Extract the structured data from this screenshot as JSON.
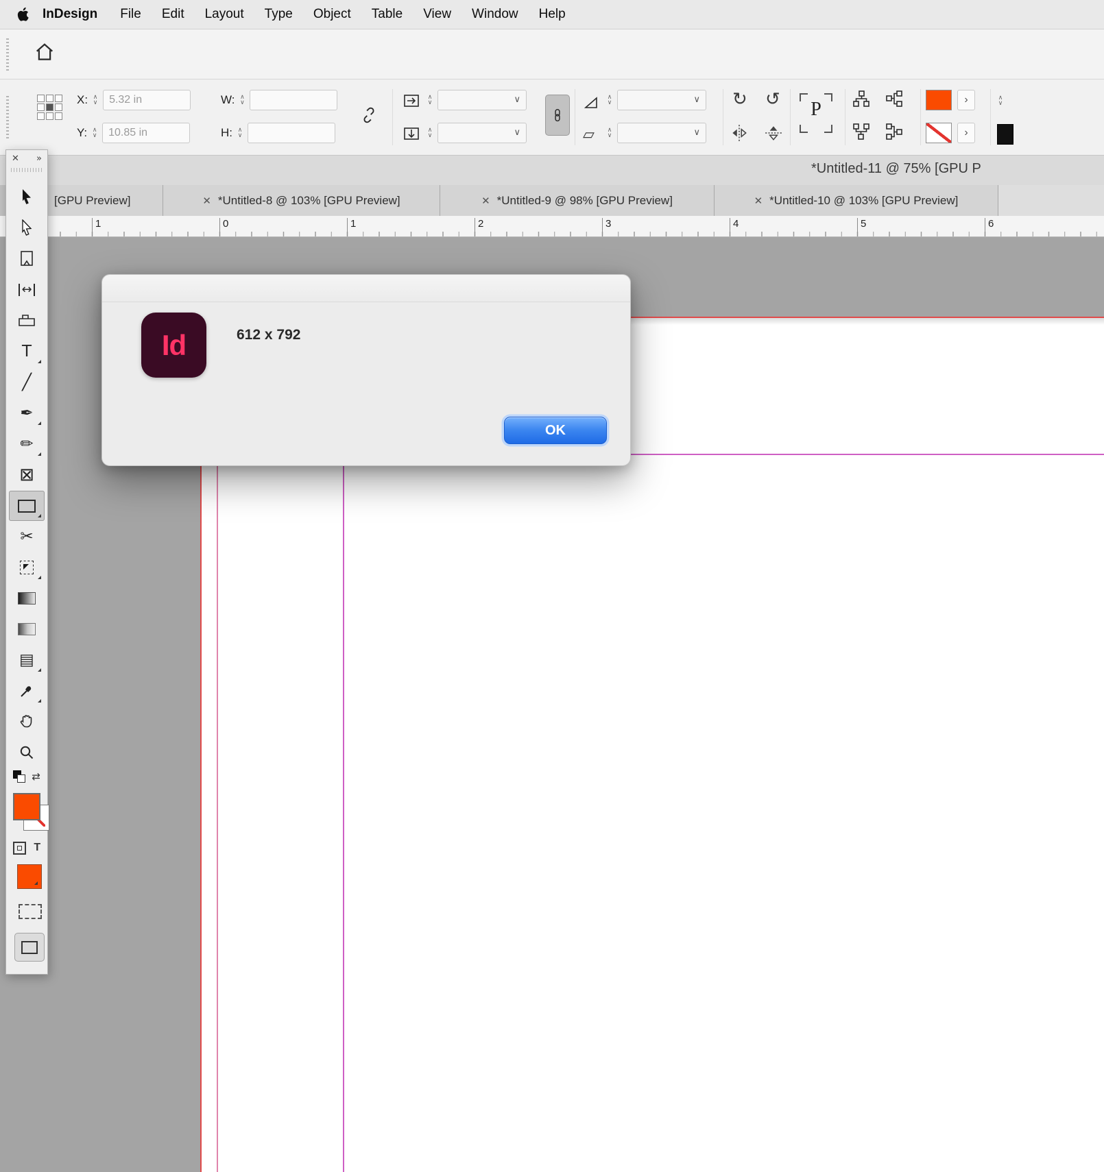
{
  "menu_bar": {
    "app_name": "InDesign",
    "items": [
      "File",
      "Edit",
      "Layout",
      "Type",
      "Object",
      "Table",
      "View",
      "Window",
      "Help"
    ]
  },
  "control_panel": {
    "x_label": "X:",
    "x_value": "5.32 in",
    "y_label": "Y:",
    "y_value": "10.85 in",
    "w_label": "W:",
    "w_value": "",
    "h_label": "H:",
    "h_value": "",
    "paragraph_symbol": "P"
  },
  "document_window": {
    "title": "*Untitled-11 @ 75% [GPU P"
  },
  "tabs": [
    {
      "label": "[GPU Preview]"
    },
    {
      "label": "*Untitled-8 @ 103% [GPU Preview]"
    },
    {
      "label": "*Untitled-9 @ 98% [GPU Preview]"
    },
    {
      "label": "*Untitled-10 @ 103% [GPU Preview]"
    }
  ],
  "ruler": {
    "numbers": [
      "1",
      "0",
      "1",
      "2",
      "3",
      "4",
      "5",
      "6"
    ]
  },
  "dialog": {
    "message": "612 x 792",
    "ok_label": "OK",
    "app_icon_text": "Id"
  },
  "icons": {
    "close": "✕",
    "panel_collapse": "»",
    "chevron_down": "∨",
    "stepper_up": "∧",
    "stepper_down": "∨",
    "chevron_right": "›",
    "type_tool": "T",
    "line_tool": "╱",
    "pen_tool": "✒",
    "pencil_tool": "✏",
    "frame_tool": "⊠",
    "scissors_tool": "✂",
    "gap_tool": "↔",
    "note_tool": "▤",
    "rotate_cw": "↻",
    "rotate_ccw": "↺",
    "swap_fill_stroke": "⇄",
    "text_affects": "T",
    "parallelogram": "▱"
  },
  "colors": {
    "accent_orange": "#FA4B00",
    "ok_button_blue": "#2D7BF0",
    "indesign_icon_bg": "#3A0B24",
    "indesign_icon_text": "#FF3366",
    "guide_red": "#E14B4B",
    "guide_magenta": "#CE5FC4",
    "guide_pink": "#E084AC",
    "pasteboard_gray": "#A4A4A4"
  }
}
